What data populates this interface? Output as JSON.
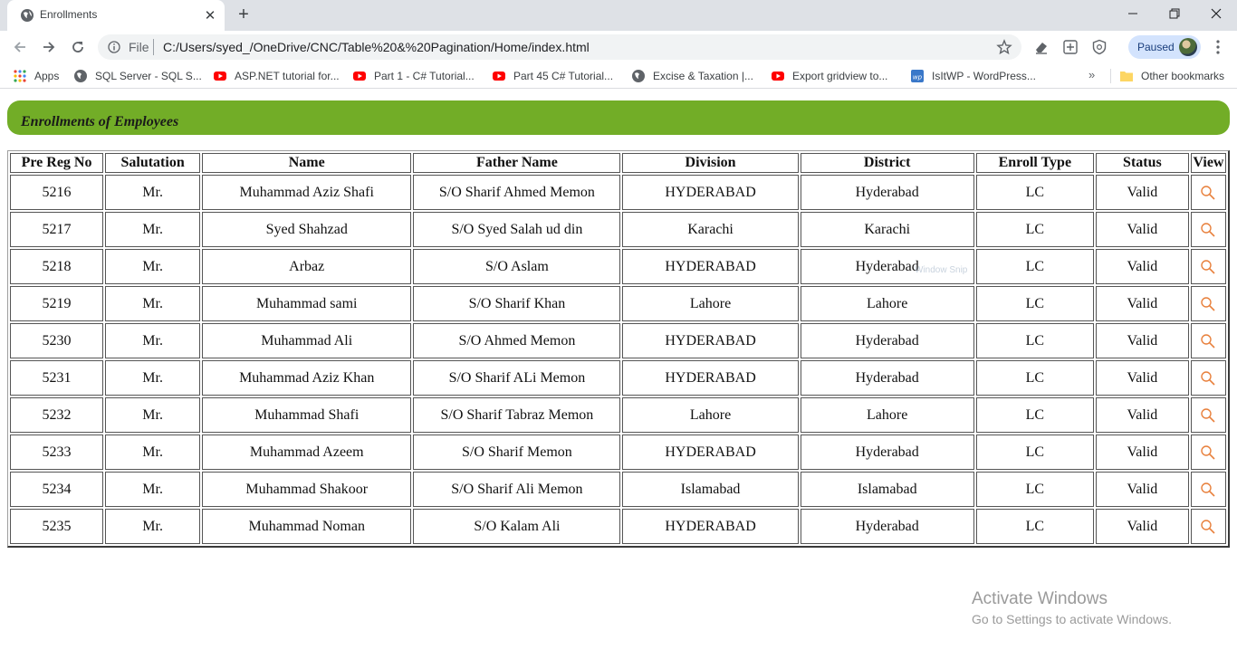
{
  "browser": {
    "tab": {
      "title": "Enrollments",
      "close_glyph": "✕"
    },
    "new_tab_glyph": "+",
    "window_controls": {
      "minimize_glyph": "—",
      "maximize_glyph": "❐",
      "close_glyph": "✕"
    },
    "address_bar": {
      "scheme": "File",
      "url": "C:/Users/syed_/OneDrive/CNC/Table%20&%20Pagination/Home/index.html"
    },
    "profile": {
      "status": "Paused"
    },
    "bookmarks": [
      {
        "label": "Apps",
        "icon": "apps-grid-icon"
      },
      {
        "label": "SQL Server - SQL S...",
        "icon": "globe-icon"
      },
      {
        "label": "ASP.NET tutorial for...",
        "icon": "youtube-icon"
      },
      {
        "label": "Part 1 - C# Tutorial...",
        "icon": "youtube-icon"
      },
      {
        "label": "Part 45 C# Tutorial...",
        "icon": "youtube-icon"
      },
      {
        "label": "Excise & Taxation |...",
        "icon": "globe-icon"
      },
      {
        "label": "Export gridview to...",
        "icon": "youtube-icon"
      },
      {
        "label": "IsItWP - WordPress...",
        "icon": "wordpress-icon"
      }
    ],
    "more_bookmarks_glyph": "»",
    "other_bookmarks": "Other bookmarks"
  },
  "page": {
    "title": "Enrollments of Employees",
    "table": {
      "columns": [
        "Pre Reg No",
        "Salutation",
        "Name",
        "Father Name",
        "Division",
        "District",
        "Enroll Type",
        "Status",
        "View"
      ],
      "rows": [
        [
          "5216",
          "Mr.",
          "Muhammad Aziz Shafi",
          "S/O Sharif Ahmed Memon",
          "HYDERABAD",
          "Hyderabad",
          "LC",
          "Valid"
        ],
        [
          "5217",
          "Mr.",
          "Syed Shahzad",
          "S/O Syed Salah ud din",
          "Karachi",
          "Karachi",
          "LC",
          "Valid"
        ],
        [
          "5218",
          "Mr.",
          "Arbaz",
          "S/O Aslam",
          "HYDERABAD",
          "Hyderabad",
          "LC",
          "Valid"
        ],
        [
          "5219",
          "Mr.",
          "Muhammad sami",
          "S/O Sharif Khan",
          "Lahore",
          "Lahore",
          "LC",
          "Valid"
        ],
        [
          "5230",
          "Mr.",
          "Muhammad Ali",
          "S/O Ahmed Memon",
          "HYDERABAD",
          "Hyderabad",
          "LC",
          "Valid"
        ],
        [
          "5231",
          "Mr.",
          "Muhammad Aziz Khan",
          "S/O Sharif ALi Memon",
          "HYDERABAD",
          "Hyderabad",
          "LC",
          "Valid"
        ],
        [
          "5232",
          "Mr.",
          "Muhammad Shafi",
          "S/O Sharif Tabraz Memon",
          "Lahore",
          "Lahore",
          "LC",
          "Valid"
        ],
        [
          "5233",
          "Mr.",
          "Muhammad Azeem",
          "S/O Sharif Memon",
          "HYDERABAD",
          "Hyderabad",
          "LC",
          "Valid"
        ],
        [
          "5234",
          "Mr.",
          "Muhammad Shakoor",
          "S/O Sharif Ali Memon",
          "Islamabad",
          "Islamabad",
          "LC",
          "Valid"
        ],
        [
          "5235",
          "Mr.",
          "Muhammad Noman",
          "S/O Kalam Ali",
          "HYDERABAD",
          "Hyderabad",
          "LC",
          "Valid"
        ]
      ],
      "view_icon": "search-icon"
    }
  },
  "overlays": {
    "snip_ghost": "Window Snip",
    "activate_title": "Activate Windows",
    "activate_subtitle": "Go to Settings to activate Windows."
  },
  "colors": {
    "header_green": "#72ad27",
    "view_icon_orange": "#e8803c",
    "chrome_tabstrip": "#dee1e6"
  }
}
